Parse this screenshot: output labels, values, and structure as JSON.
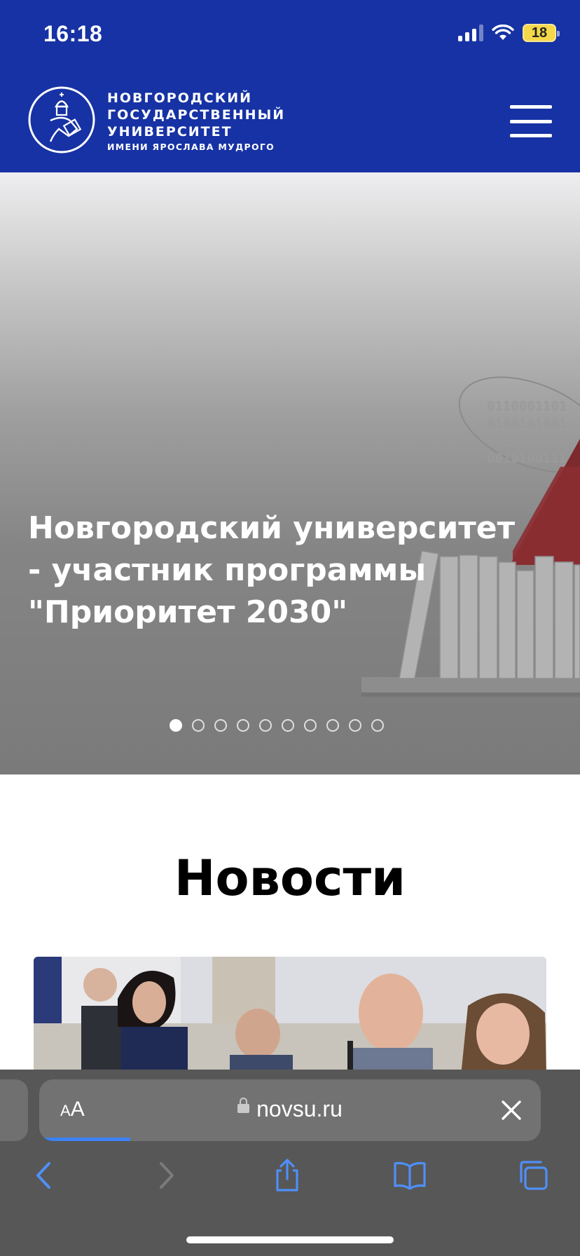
{
  "status_bar": {
    "time": "16:18",
    "battery_level": "18"
  },
  "header": {
    "logo_lines": [
      "НОВГОРОДСКИЙ",
      "ГОСУДАРСТВЕННЫЙ",
      "УНИВЕРСИТЕТ"
    ],
    "logo_subline": "ИМЕНИ ЯРОСЛАВА МУДРОГО",
    "menu_icon": "hamburger-menu-icon",
    "brand_color": "#1632A4"
  },
  "hero": {
    "title": "Новгородский университет - участник программы \"Приоритет 2030\"",
    "binary_text": [
      "0110001101",
      "0100101001",
      "0011000111",
      "0010100111"
    ],
    "slide_count": 10,
    "active_slide": 1
  },
  "news": {
    "heading": "Новости"
  },
  "browser": {
    "text_size_label_small": "A",
    "text_size_label_large": "A",
    "url": "novsu.ru",
    "icons": [
      "back-arrow-icon",
      "forward-arrow-icon",
      "share-icon",
      "bookmarks-icon",
      "tabs-icon"
    ]
  }
}
